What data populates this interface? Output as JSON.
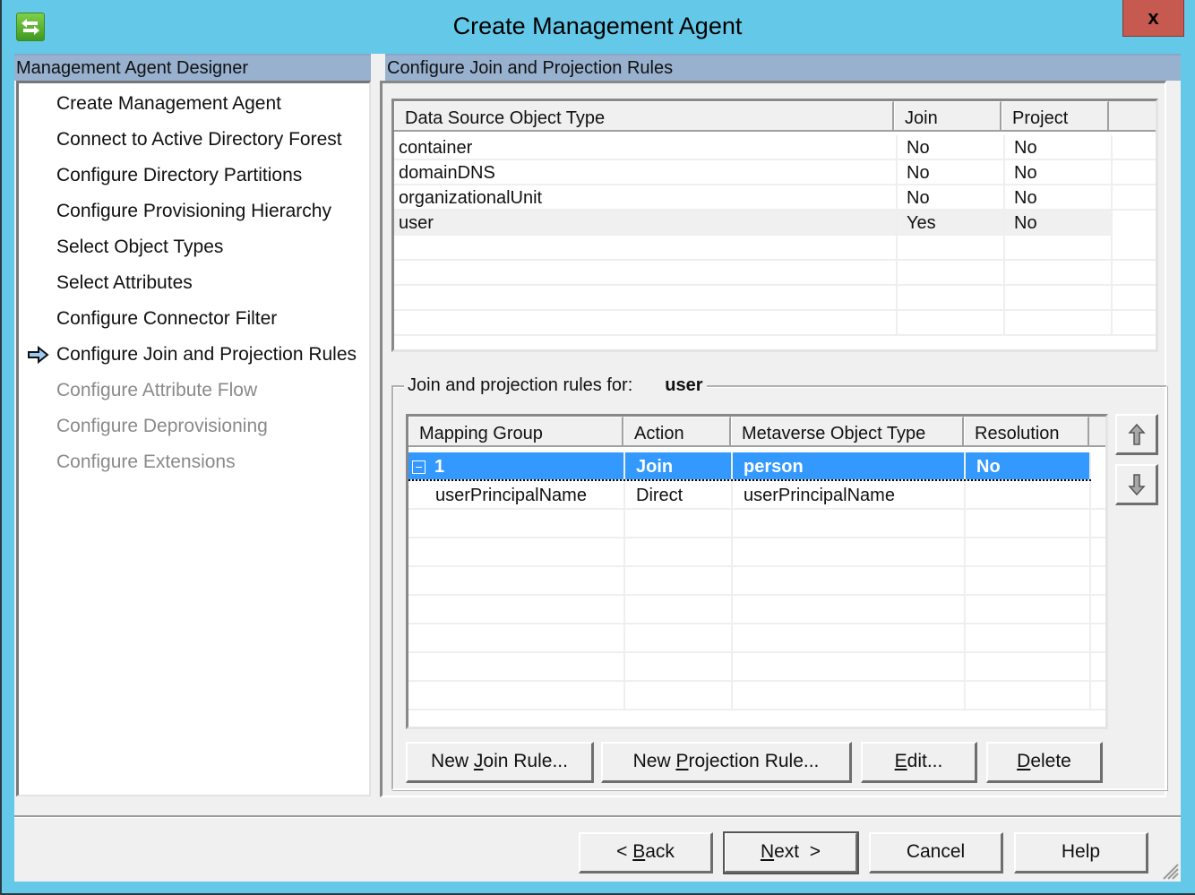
{
  "window": {
    "title": "Create Management Agent",
    "close_label": "x",
    "app_icon": "sync-arrows-icon"
  },
  "sidebar": {
    "header": "Management Agent Designer",
    "current_marker_icon": "right-arrow-icon",
    "items": [
      {
        "label": "Create Management Agent",
        "state": "done"
      },
      {
        "label": "Connect to Active Directory Forest",
        "state": "done"
      },
      {
        "label": "Configure Directory Partitions",
        "state": "done"
      },
      {
        "label": "Configure Provisioning Hierarchy",
        "state": "done"
      },
      {
        "label": "Select Object Types",
        "state": "done"
      },
      {
        "label": "Select Attributes",
        "state": "done"
      },
      {
        "label": "Configure Connector Filter",
        "state": "done"
      },
      {
        "label": "Configure Join and Projection Rules",
        "state": "current"
      },
      {
        "label": "Configure Attribute Flow",
        "state": "disabled"
      },
      {
        "label": "Configure Deprovisioning",
        "state": "disabled"
      },
      {
        "label": "Configure Extensions",
        "state": "disabled"
      }
    ]
  },
  "main": {
    "header": "Configure Join and Projection Rules",
    "object_types_table": {
      "columns": [
        "Data Source Object Type",
        "Join",
        "Project"
      ],
      "rows": [
        {
          "type": "container",
          "join": "No",
          "project": "No"
        },
        {
          "type": "domainDNS",
          "join": "No",
          "project": "No"
        },
        {
          "type": "organizationalUnit",
          "join": "No",
          "project": "No"
        },
        {
          "type": "user",
          "join": "Yes",
          "project": "No",
          "selected": true
        }
      ]
    },
    "rules_group": {
      "label": "Join and projection rules for:",
      "object_type": "user",
      "columns": [
        "Mapping Group",
        "Action",
        "Metaverse Object Type",
        "Resolution"
      ],
      "rows": [
        {
          "mapping_group": "1",
          "action": "Join",
          "metaverse_type": "person",
          "resolution": "No",
          "selected": true,
          "expander": "collapse"
        },
        {
          "mapping_group": "userPrincipalName",
          "action": "Direct",
          "metaverse_type": "userPrincipalName",
          "resolution": ""
        }
      ],
      "move_up_icon": "arrow-up-icon",
      "move_down_icon": "arrow-down-icon",
      "buttons": {
        "new_join": {
          "pre": "New ",
          "key": "J",
          "post": "oin Rule..."
        },
        "new_projection": {
          "pre": "New ",
          "key": "P",
          "post": "rojection Rule..."
        },
        "edit": {
          "pre": "",
          "key": "E",
          "post": "dit..."
        },
        "delete": {
          "pre": "",
          "key": "D",
          "post": "elete"
        }
      }
    }
  },
  "footer": {
    "back": {
      "pre": "< ",
      "key": "B",
      "post": "ack"
    },
    "next": {
      "pre": "",
      "key": "N",
      "post": "ext  >"
    },
    "cancel": "Cancel",
    "help": "Help"
  },
  "colors": {
    "titlebar": "#64c9e9",
    "close": "#c75a50",
    "header_band": "#97b1cf",
    "selection": "#3399ff"
  }
}
